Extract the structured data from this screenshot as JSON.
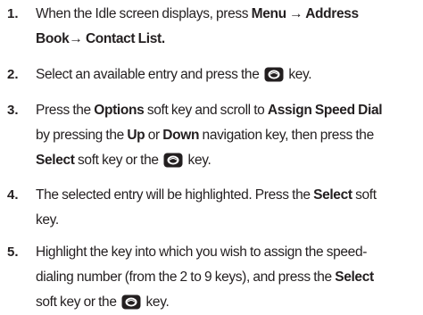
{
  "steps": [
    {
      "number": "1.",
      "lines": [
        [
          {
            "t": "When the Idle screen displays, press "
          },
          {
            "b": "Menu → Address"
          }
        ],
        [
          {
            "b": "Book→ Contact List."
          }
        ]
      ]
    },
    {
      "number": "2.",
      "lines": [
        [
          {
            "t": "Select an available entry and press the "
          },
          {
            "icon": "ok-key-icon"
          },
          {
            "t": " key."
          }
        ]
      ]
    },
    {
      "number": "3.",
      "lines": [
        [
          {
            "t": "Press the "
          },
          {
            "b": "Options"
          },
          {
            "t": " soft key and scroll to "
          },
          {
            "b": "Assign Speed Dial"
          }
        ],
        [
          {
            "t": "by pressing the "
          },
          {
            "b": "Up"
          },
          {
            "t": " or "
          },
          {
            "b": "Down"
          },
          {
            "t": " navigation key, then press the"
          }
        ],
        [
          {
            "b": "Select"
          },
          {
            "t": " soft key or the "
          },
          {
            "icon": "ok-key-icon"
          },
          {
            "t": " key."
          }
        ]
      ]
    },
    {
      "number": "4.",
      "lines": [
        [
          {
            "t": "The selected entry will be highlighted. Press the "
          },
          {
            "b": "Select"
          },
          {
            "t": " soft"
          }
        ],
        [
          {
            "t": "key."
          }
        ]
      ]
    },
    {
      "number": "5.",
      "lines": [
        [
          {
            "t": "Highlight the key into which you wish to assign the speed-"
          }
        ],
        [
          {
            "t": "dialing number (from the 2 to 9 keys), and press the "
          },
          {
            "b": "Select"
          }
        ],
        [
          {
            "t": "soft key or the "
          },
          {
            "icon": "ok-key-icon"
          },
          {
            "t": " key."
          }
        ]
      ]
    }
  ]
}
